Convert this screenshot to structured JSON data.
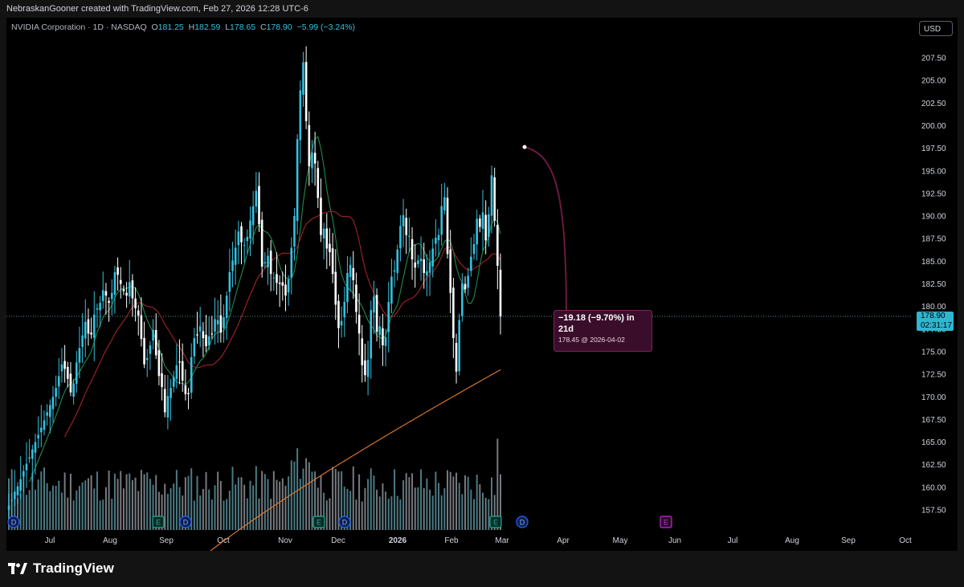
{
  "header": {
    "title": "NebraskanGooner created with TradingView.com, Feb 27, 2026 12:28 UTC-6"
  },
  "legend": {
    "symbol": "NVIDIA Corporation · 1D · NASDAQ",
    "open_label": "O",
    "open": "181.25",
    "high_label": "H",
    "high": "182.59",
    "low_label": "L",
    "low": "178.65",
    "close_label": "C",
    "close": "178.90",
    "change": "−5.99 (−3.24%)"
  },
  "currency_button": {
    "label": "USD"
  },
  "last_price": {
    "price": "178.90",
    "countdown": "02:31:17"
  },
  "projection": {
    "main": "−19.18 (−9.70%) in 21d",
    "sub": "178.45 @ 2026-04-02",
    "start_value": 197.63,
    "end_value": 178.45,
    "start_date": "2026-03-12",
    "end_date": "2026-04-02"
  },
  "footer": {
    "brand": "TradingView"
  },
  "colors": {
    "up": "#35c0de",
    "down": "#ffffff",
    "ma_fast": "#1e8a4d",
    "ma_mid": "#a2232a",
    "ma_slow": "#e57c2a",
    "projection": "#6b1a3f",
    "event_dividend": "#2962ff",
    "event_earnings": "#22ab94",
    "event_future_earnings": "#c32bd0"
  },
  "chart_data": {
    "type": "line",
    "title": "NVIDIA Corporation · 1D · NASDAQ",
    "ylim": [
      155.5,
      210.5
    ],
    "y_ticks": [
      "157.50",
      "160.00",
      "162.50",
      "165.00",
      "167.50",
      "170.00",
      "172.50",
      "175.00",
      "177.50",
      "180.00",
      "182.50",
      "185.00",
      "187.50",
      "190.00",
      "192.50",
      "195.00",
      "197.50",
      "200.00",
      "202.50",
      "205.00",
      "207.50"
    ],
    "x_ticks": [
      "Jul",
      "Aug",
      "Sep",
      "Oct",
      "Nov",
      "Dec",
      "2026",
      "Feb",
      "Mar",
      "Apr",
      "May",
      "Jun",
      "Jul",
      "Aug",
      "Sep",
      "Oct"
    ],
    "series": [
      {
        "name": "Close",
        "values": [
          158.0,
          158.6,
          159.5,
          160.1,
          160.9,
          161.8,
          162.6,
          163.3,
          164.2,
          165.0,
          165.8,
          166.6,
          167.4,
          168.3,
          169.1,
          170.0,
          171.0,
          172.3,
          173.6,
          173.1,
          172.0,
          170.5,
          171.5,
          173.8,
          175.4,
          176.8,
          178.3,
          177.0,
          176.9,
          179.1,
          179.8,
          180.4,
          181.8,
          181.2,
          180.4,
          181.5,
          183.8,
          183.5,
          182.5,
          181.7,
          181.2,
          182.7,
          180.9,
          179.8,
          179.0,
          176.4,
          173.6,
          174.3,
          175.7,
          177.4,
          174.6,
          172.3,
          171.1,
          168.3,
          170.1,
          171.0,
          172.2,
          173.5,
          173.8,
          171.8,
          170.3,
          170.3,
          174.4,
          176.5,
          176.8,
          177.8,
          176.5,
          175.6,
          176.7,
          176.9,
          178.6,
          178.5,
          177.1,
          178.8,
          181.2,
          183.8,
          185.1,
          186.5,
          188.3,
          187.1,
          186.8,
          187.7,
          189.5,
          191.1,
          192.8,
          189.1,
          184.4,
          184.9,
          185.6,
          183.6,
          183.2,
          182.6,
          182.5,
          182.3,
          181.2,
          183.0,
          186.5,
          190.0,
          198.5,
          203.9,
          207.0,
          200.5,
          195.5,
          197.0,
          195.8,
          192.0,
          187.9,
          188.6,
          186.4,
          186.0,
          183.6,
          180.2,
          177.6,
          178.4,
          180.5,
          183.7,
          184.6,
          182.9,
          179.4,
          177.0,
          173.5,
          172.4,
          174.1,
          179.6,
          181.1,
          177.2,
          177.8,
          175.7,
          176.6,
          180.5,
          183.3,
          184.0,
          186.3,
          188.9,
          190.1,
          187.9,
          187.8,
          185.2,
          184.3,
          185.1,
          185.3,
          183.7,
          183.9,
          184.9,
          186.4,
          187.6,
          187.9,
          191.1,
          192.1,
          185.8,
          181.5,
          176.5,
          172.8,
          178.5,
          182.6,
          181.9,
          183.4,
          185.5,
          186.9,
          189.7,
          188.8,
          190.4,
          187.3,
          190.2,
          194.5,
          189.5,
          184.5,
          178.9
        ]
      }
    ],
    "moving_averages": [
      "fast (green)",
      "mid (red)",
      "slow (orange)"
    ],
    "events": [
      {
        "type": "dividend",
        "label": "D",
        "date": "Jun"
      },
      {
        "type": "earnings",
        "label": "E",
        "date": "Aug"
      },
      {
        "type": "dividend",
        "label": "D",
        "date": "Sep"
      },
      {
        "type": "earnings",
        "label": "E",
        "date": "Nov"
      },
      {
        "type": "dividend",
        "label": "D",
        "date": "Dec"
      },
      {
        "type": "earnings",
        "label": "E",
        "date": "Feb"
      },
      {
        "type": "dividend",
        "label": "D",
        "date": "Mar"
      },
      {
        "type": "future_earnings",
        "label": "E",
        "date": "May"
      }
    ],
    "grid": false,
    "legend_position": "top-left"
  }
}
